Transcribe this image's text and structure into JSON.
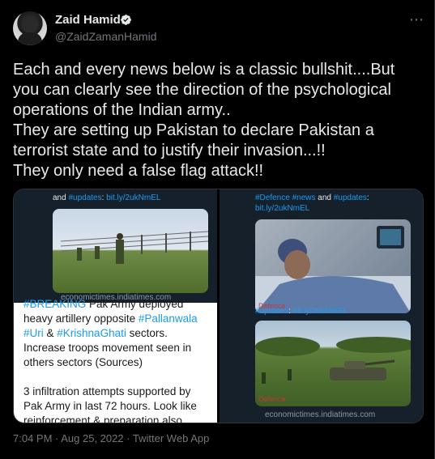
{
  "user": {
    "name": "Zaid Hamid",
    "handle": "@ZaidZamanHamid"
  },
  "tweet": {
    "lines": [
      "Each and every news below is a classic bullshit....But",
      "you can clearly see the direction of the psychological",
      "operations of the Indian army..",
      "They are setting up Pakistan to declare Pakistan a",
      "terrorist state and to justify their invasion...!!",
      "They only need a false flag attack!!"
    ]
  },
  "media": {
    "left": {
      "caption_prefix": "and ",
      "caption_link": "#updates",
      "caption_colon": ": ",
      "caption_url": "bit.ly/2ukNmEL",
      "source": "economictimes.indiatimes.com",
      "screenshot_lines": [
        [
          "#BREAKING",
          " ",
          "Pak Army deployed"
        ],
        [
          "heavy artillery opposite ",
          "#Pallanwala",
          ""
        ],
        [
          "#Uri",
          " & ",
          "#KrishnaGhati",
          " sectors."
        ],
        [
          "Increase troops movement seen in"
        ],
        [
          "others sectors (Sources)"
        ],
        [
          ""
        ],
        [
          "3 infiltration attempts supported by"
        ],
        [
          "Pak Army in last 72 hours. Look like"
        ],
        [
          "reinforcement & preparation also"
        ]
      ]
    },
    "right": {
      "caption_top_1": "#Defence",
      "caption_top_2": " ",
      "caption_top_3": "#news",
      "caption_top_4": " and ",
      "caption_top_5": "#updates",
      "caption_top_6": ":",
      "caption_top_url": "bit.ly/2ukNmEL",
      "caption_mid_link": "#updates",
      "caption_mid_colon": ": ",
      "caption_mid_url": "bit.ly/2ukNmEL",
      "logo_1": "Defence",
      "logo_2": "Defence",
      "source": "economictimes.indiatimes.com"
    }
  },
  "footer": {
    "time": "7:04 PM · Aug 25, 2022 · Twitter Web App"
  },
  "colors": {
    "background": "#000000",
    "text": "#e7e9ea",
    "muted": "#71767b",
    "link": "#1d9bf0"
  },
  "icons": {
    "verified": "verified-badge-icon",
    "more": "more-icon"
  }
}
